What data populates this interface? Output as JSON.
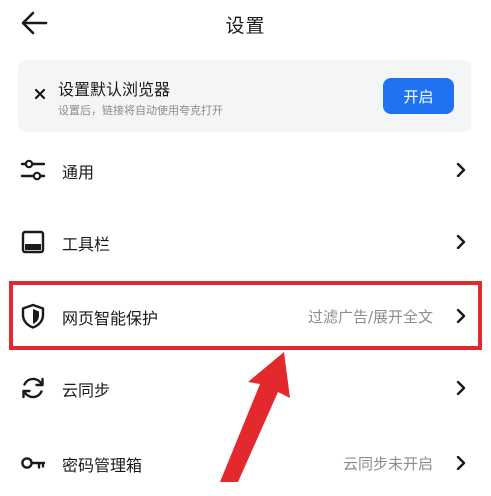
{
  "header": {
    "title": "设置",
    "back_icon": "back-arrow-icon"
  },
  "banner": {
    "title": "设置默认浏览器",
    "subtitle": "设置后，链接将自动使用夸克打开",
    "button_label": "开启",
    "close_icon": "close-icon"
  },
  "settings": {
    "items": [
      {
        "label": "通用",
        "value": "",
        "icon": "sliders-icon"
      },
      {
        "label": "工具栏",
        "value": "",
        "icon": "toolbar-icon"
      },
      {
        "label": "网页智能保护",
        "value": "过滤广告/展开全文",
        "icon": "shield-icon"
      },
      {
        "label": "云同步",
        "value": "",
        "icon": "sync-icon"
      },
      {
        "label": "密码管理箱",
        "value": "云同步未开启",
        "icon": "key-icon"
      }
    ]
  },
  "colors": {
    "accent": "#1f73f0",
    "annotation_red": "#e3282e",
    "banner_bg": "#f4f5f7",
    "secondary_text": "#8c8c8c"
  }
}
